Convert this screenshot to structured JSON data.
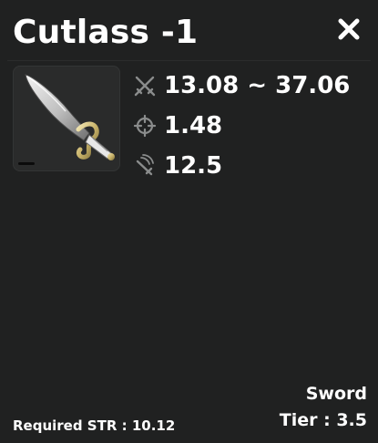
{
  "item": {
    "name": "Cutlass -1",
    "icon": "cutlass-sword-image"
  },
  "close": {
    "icon": "close-icon",
    "glyph": "✕"
  },
  "stats": [
    {
      "icon": "crossed-swords-icon",
      "value": "13.08 ~ 37.06"
    },
    {
      "icon": "crosshair-icon",
      "value": "1.48"
    },
    {
      "icon": "sword-speed-icon",
      "value": "12.5"
    }
  ],
  "requirements": {
    "text": "Required STR : 10.12"
  },
  "classification": {
    "type": "Sword",
    "tier": "Tier : 3.5"
  },
  "colors": {
    "background": "#202121",
    "icon_gray": "#8a8c8c",
    "text": "#ffffff"
  }
}
